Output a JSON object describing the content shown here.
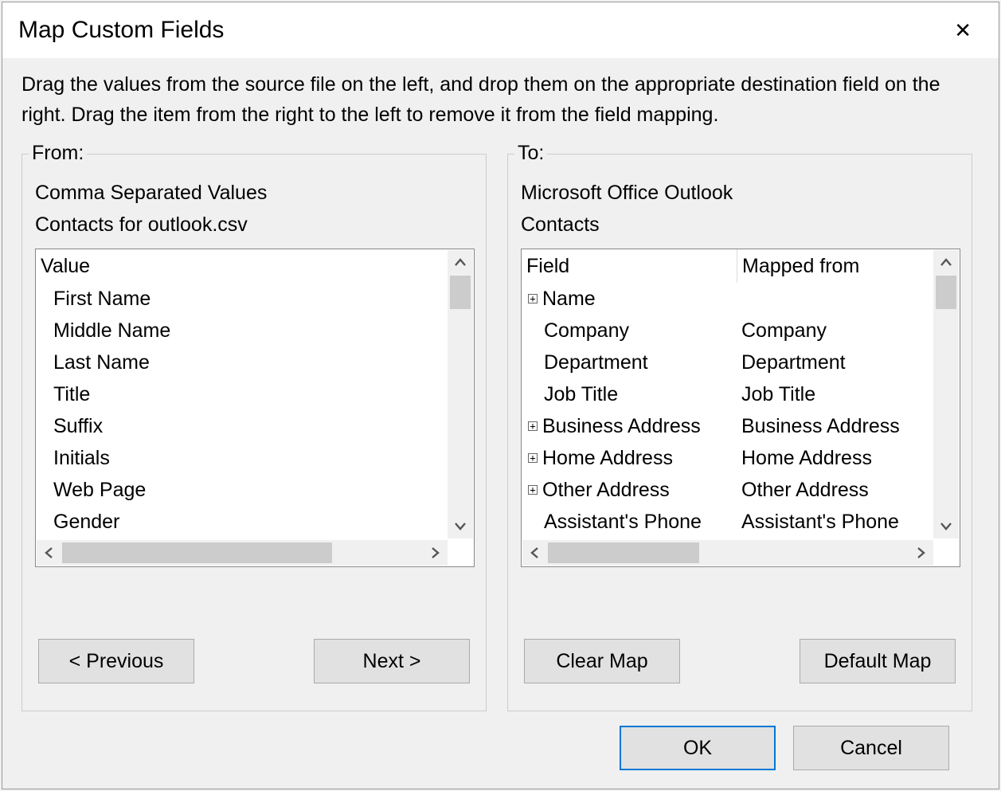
{
  "title": "Map Custom Fields",
  "close_glyph": "✕",
  "instructions": "Drag the values from the source file on the left, and drop them on the appropriate destination field on the right.  Drag the item from the right to the left to remove it from the field mapping.",
  "from": {
    "legend": "From:",
    "line1": "Comma Separated Values",
    "line2": "Contacts for outlook.csv",
    "header": "Value",
    "items": [
      "First Name",
      "Middle Name",
      "Last Name",
      "Title",
      "Suffix",
      "Initials",
      "Web Page",
      "Gender"
    ],
    "buttons": {
      "prev": "< Previous",
      "next": "Next >"
    }
  },
  "to": {
    "legend": "To:",
    "line1": "Microsoft Office Outlook",
    "line2": "Contacts",
    "headers": {
      "field": "Field",
      "mapped": "Mapped from"
    },
    "rows": [
      {
        "expandable": true,
        "field": "Name",
        "mapped": ""
      },
      {
        "expandable": false,
        "field": "Company",
        "mapped": "Company"
      },
      {
        "expandable": false,
        "field": "Department",
        "mapped": "Department"
      },
      {
        "expandable": false,
        "field": "Job Title",
        "mapped": "Job Title"
      },
      {
        "expandable": true,
        "field": "Business Address",
        "mapped": "Business Address"
      },
      {
        "expandable": true,
        "field": "Home Address",
        "mapped": "Home Address"
      },
      {
        "expandable": true,
        "field": "Other Address",
        "mapped": "Other Address"
      },
      {
        "expandable": false,
        "field": "Assistant's Phone",
        "mapped": "Assistant's Phone"
      }
    ],
    "buttons": {
      "clear": "Clear Map",
      "default": "Default Map"
    }
  },
  "footer": {
    "ok": "OK",
    "cancel": "Cancel"
  },
  "icons": {
    "plus": "+"
  }
}
